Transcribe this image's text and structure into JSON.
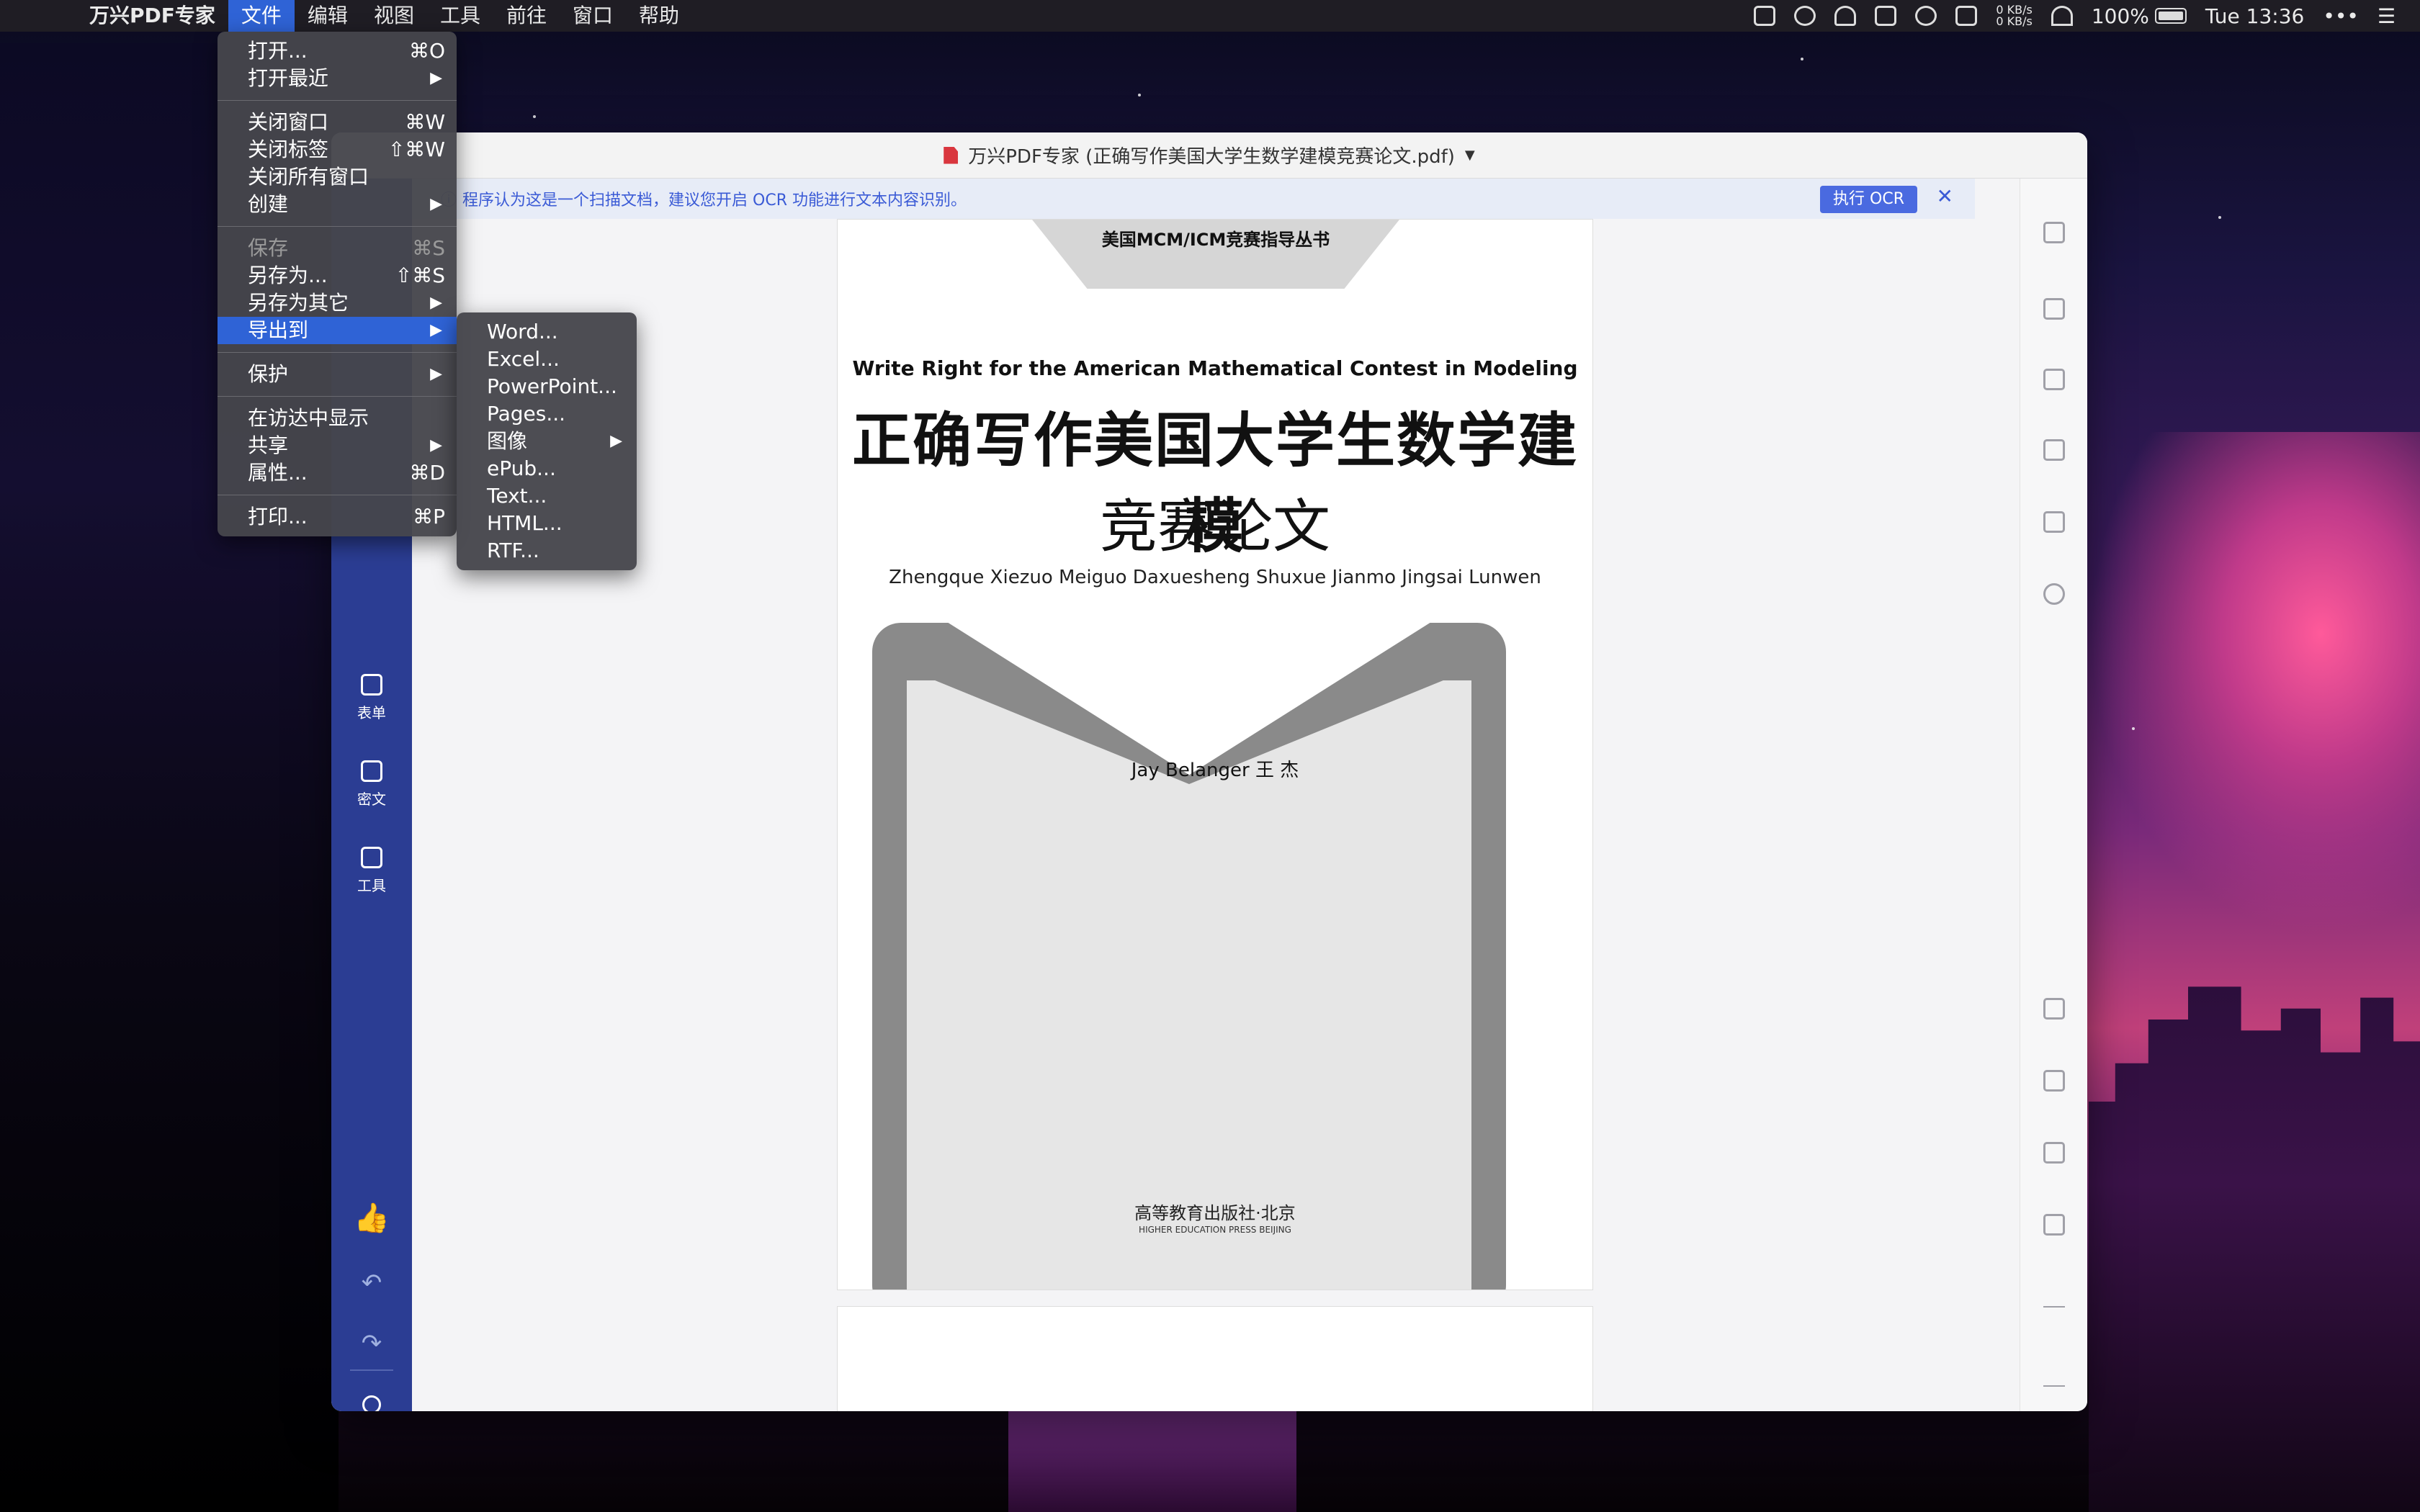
{
  "menubar": {
    "app_name": "万兴PDF专家",
    "items": [
      "文件",
      "编辑",
      "视图",
      "工具",
      "前往",
      "窗口",
      "帮助"
    ],
    "network": [
      "0 KB/s",
      "0 KB/s"
    ],
    "battery": "100%",
    "clock": "Tue 13:36"
  },
  "window": {
    "title": "万兴PDF专家 (正确写作美国大学生数学建模竞赛论文.pdf)"
  },
  "ocr_bar": {
    "message": "程序认为这是一个扫描文档，建议您开启 OCR 功能进行文本内容识别。",
    "button": "执行 OCR"
  },
  "left_rail": {
    "items": [
      "表单",
      "密文",
      "工具"
    ]
  },
  "document": {
    "series": "美国MCM/ICM竞赛指导丛书",
    "en_title": "Write Right for the American Mathematical Contest in Modeling",
    "cn_title_1": "正确写作美国大学生数学建模",
    "cn_title_2": "竞赛论文",
    "pinyin": "Zhengque Xiezuo Meiguo Daxuesheng Shuxue Jianmo Jingsai Lunwen",
    "authors": "Jay Belanger    王  杰",
    "publisher": "高等教育出版社·北京",
    "publisher_en": "HIGHER EDUCATION PRESS  BEIJING"
  },
  "file_menu": {
    "groups": [
      [
        {
          "label": "打开...",
          "shortcut": "⌘O"
        },
        {
          "label": "打开最近",
          "submenu": true
        }
      ],
      [
        {
          "label": "关闭窗口",
          "shortcut": "⌘W"
        },
        {
          "label": "关闭标签",
          "shortcut": "⇧⌘W"
        },
        {
          "label": "关闭所有窗口"
        },
        {
          "label": "创建",
          "submenu": true
        }
      ],
      [
        {
          "label": "保存",
          "shortcut": "⌘S",
          "disabled": true
        },
        {
          "label": "另存为...",
          "shortcut": "⇧⌘S"
        },
        {
          "label": "另存为其它",
          "submenu": true
        },
        {
          "label": "导出到",
          "submenu": true,
          "selected": true
        }
      ],
      [
        {
          "label": "保护",
          "submenu": true
        }
      ],
      [
        {
          "label": "在访达中显示"
        },
        {
          "label": "共享",
          "submenu": true
        },
        {
          "label": "属性...",
          "shortcut": "⌘D"
        }
      ],
      [
        {
          "label": "打印...",
          "shortcut": "⌘P"
        }
      ]
    ]
  },
  "export_menu": {
    "items": [
      {
        "label": "Word..."
      },
      {
        "label": "Excel..."
      },
      {
        "label": "PowerPoint..."
      },
      {
        "label": "Pages..."
      },
      {
        "label": "图像",
        "submenu": true
      },
      {
        "label": "ePub..."
      },
      {
        "label": "Text..."
      },
      {
        "label": "HTML..."
      },
      {
        "label": "RTF..."
      }
    ]
  }
}
